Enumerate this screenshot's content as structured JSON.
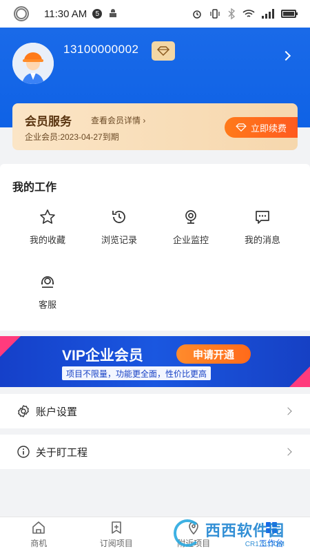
{
  "status_bar": {
    "time": "11:30 AM",
    "badge": "5"
  },
  "header": {
    "phone": "13100000002",
    "avatar_icon": "worker-avatar-icon",
    "vip_icon": "diamond-icon"
  },
  "membership": {
    "title": "会员服务",
    "detail_link": "查看会员详情",
    "expire": "企业会员:2023-04-27到期",
    "renew_label": "立即续费"
  },
  "work": {
    "title": "我的工作",
    "items": [
      {
        "label": "我的收藏",
        "icon": "star-icon"
      },
      {
        "label": "浏览记录",
        "icon": "history-icon"
      },
      {
        "label": "企业监控",
        "icon": "camera-icon"
      },
      {
        "label": "我的消息",
        "icon": "message-icon"
      },
      {
        "label": "客服",
        "icon": "headset-icon"
      }
    ]
  },
  "banner": {
    "vip_text": "VIP企业会员",
    "apply_label": "申请开通",
    "subtitle": "项目不限量，功能更全面，性价比更高"
  },
  "settings": {
    "account_label": "账户设置",
    "about_label": "关于盯工程"
  },
  "tabs": [
    {
      "label": "商机",
      "icon": "home-icon",
      "active": false
    },
    {
      "label": "订阅项目",
      "icon": "bookmark-icon",
      "active": false
    },
    {
      "label": "附近项目",
      "icon": "location-icon",
      "active": false
    },
    {
      "label": "工作台",
      "icon": "workbench-icon",
      "active": true
    }
  ],
  "watermark": {
    "text": "西西软件园",
    "url_text": "CR173.COM"
  },
  "colors": {
    "primary": "#1a6ae8",
    "accent": "#ff6a1a",
    "gold": "#f6d7ad"
  }
}
